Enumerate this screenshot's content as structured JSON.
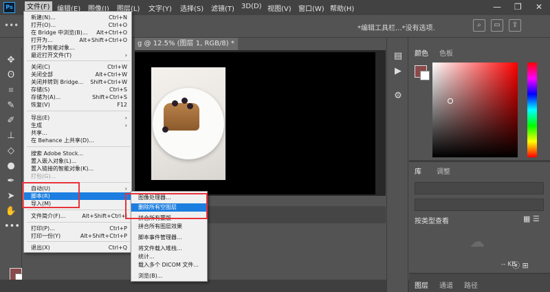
{
  "app": {
    "logo": "Ps"
  },
  "menubar": {
    "items": [
      "文件(F)",
      "编辑(E)",
      "图像(I)",
      "图层(L)",
      "文字(Y)",
      "选择(S)",
      "滤镜(T)",
      "3D(D)",
      "视图(V)",
      "窗口(W)",
      "帮助(H)"
    ],
    "window_controls": [
      "—",
      "❐",
      "✕"
    ]
  },
  "options_bar": {
    "hint": "*编辑工具栏...*没有选项."
  },
  "document": {
    "tab_title": "g @ 12.5% (图层 1, RGB/8) *"
  },
  "file_menu": {
    "items": [
      {
        "label": "新建(N)...",
        "shortcut": "Ctrl+N"
      },
      {
        "label": "打开(O)...",
        "shortcut": "Ctrl+O"
      },
      {
        "label": "在 Bridge 中浏览(B)...",
        "shortcut": "Alt+Ctrl+O"
      },
      {
        "label": "打开为...",
        "shortcut": "Alt+Shift+Ctrl+O"
      },
      {
        "label": "打开为智能对象...",
        "shortcut": ""
      },
      {
        "label": "最近打开文件(T)",
        "shortcut": ""
      },
      {
        "label": "关闭(C)",
        "shortcut": "Ctrl+W"
      },
      {
        "label": "关闭全部",
        "shortcut": "Alt+Ctrl+W"
      },
      {
        "label": "关闭并转到 Bridge...",
        "shortcut": "Shift+Ctrl+W"
      },
      {
        "label": "存储(S)",
        "shortcut": "Ctrl+S"
      },
      {
        "label": "存储为(A)...",
        "shortcut": "Shift+Ctrl+S"
      },
      {
        "label": "恢复(V)",
        "shortcut": "F12"
      },
      {
        "label": "导出(E)",
        "shortcut": ""
      },
      {
        "label": "生成",
        "shortcut": ""
      },
      {
        "label": "共享...",
        "shortcut": ""
      },
      {
        "label": "在 Behance 上共享(D)...",
        "shortcut": ""
      },
      {
        "label": "搜索 Adobe Stock...",
        "shortcut": ""
      },
      {
        "label": "置入嵌入对象(L)...",
        "shortcut": ""
      },
      {
        "label": "置入链接的智能对象(K)...",
        "shortcut": ""
      },
      {
        "label": "打包(G)...",
        "shortcut": ""
      },
      {
        "label": "自动(U)",
        "shortcut": ""
      },
      {
        "label": "脚本(R)",
        "shortcut": ""
      },
      {
        "label": "导入(M)",
        "shortcut": ""
      },
      {
        "label": "文件简介(F)...",
        "shortcut": "Alt+Shift+Ctrl+I"
      },
      {
        "label": "打印(P)...",
        "shortcut": "Ctrl+P"
      },
      {
        "label": "打印一份(Y)",
        "shortcut": "Alt+Shift+Ctrl+P"
      },
      {
        "label": "退出(X)",
        "shortcut": "Ctrl+Q"
      }
    ]
  },
  "scripts_submenu": {
    "items": [
      "图像处理器...",
      "删除所有空图层",
      "拼合所有蒙版",
      "拼合所有图层效果",
      "脚本事件管理器...",
      "将文件载入堆栈...",
      "统计...",
      "载入多个 DICOM 文件...",
      "浏览(B)..."
    ]
  },
  "right_panel": {
    "color_tabs": [
      "颜色",
      "色板"
    ],
    "library_tabs": [
      "库",
      "调整"
    ],
    "library_view": "按类型查看",
    "library_size": "-- KB",
    "layers_tabs": [
      "图层",
      "通道",
      "路径"
    ]
  },
  "colors": {
    "foreground": "#8b4a4a",
    "highlight_box": "#e8313a",
    "menu_highlight": "#1c7ee0"
  }
}
